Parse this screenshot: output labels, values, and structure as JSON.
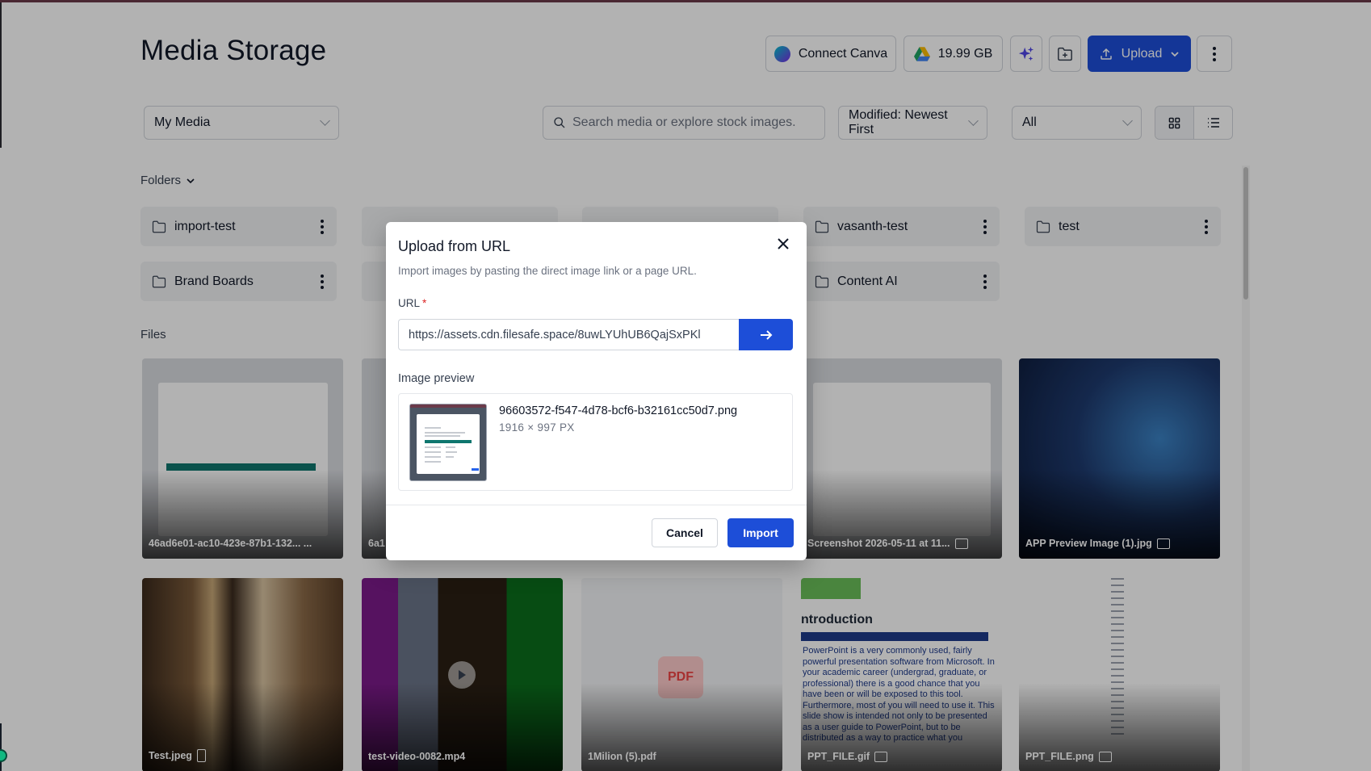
{
  "header": {
    "title": "Media Storage",
    "connect_canva": "Connect Canva",
    "storage": "19.99 GB",
    "upload": "Upload"
  },
  "filters": {
    "source": "My Media",
    "search_placeholder": "Search media or explore stock images.",
    "sort": "Modified: Newest First",
    "type": "All"
  },
  "folders_section": {
    "label": "Folders"
  },
  "folders": [
    {
      "name": "import-test"
    },
    {
      "name": "vasanth-test"
    },
    {
      "name": "test"
    },
    {
      "name": "Brand Boards"
    },
    {
      "name": "Content AI"
    }
  ],
  "files_section": {
    "label": "Files"
  },
  "files": [
    {
      "name": "46ad6e01-ac10-423e-87b1-132... ..."
    },
    {
      "name": "6a1"
    },
    {
      "name": "Screenshot 2026-05-11 at 11..."
    },
    {
      "name": "APP Preview Image (1).jpg"
    },
    {
      "name": "Test.jpeg"
    },
    {
      "name": "test-video-0082.mp4"
    },
    {
      "name": "1Milion (5).pdf",
      "badge": "PDF"
    },
    {
      "name": "PPT_FILE.gif",
      "heading": "ntroduction",
      "body": "PowerPoint is a very commonly used, fairly powerful presentation software from Microsoft. In your academic career (undergrad, graduate, or professional) there is a good chance that you have been or will be exposed to this tool. Furthermore, most of you will need to use it. This slide show is intended not only to be presented as a user guide to PowerPoint, but to be distributed as a way to practice what you"
    },
    {
      "name": "PPT_FILE.png"
    }
  ],
  "modal": {
    "title": "Upload from URL",
    "description": "Import images by pasting the direct image link or a page URL.",
    "url_label": "URL",
    "required_mark": "*",
    "url_value": "https://assets.cdn.filesafe.space/8uwLYUhUB6QajSxPKl",
    "preview_label": "Image preview",
    "preview_filename": "96603572-f547-4d78-bcf6-b32161cc50d7.png",
    "preview_dimensions": "1916 × 997 PX",
    "cancel": "Cancel",
    "import": "Import"
  },
  "colors": {
    "primary": "#1d4ed8",
    "overlay": "rgba(0,0,0,0.30)"
  }
}
